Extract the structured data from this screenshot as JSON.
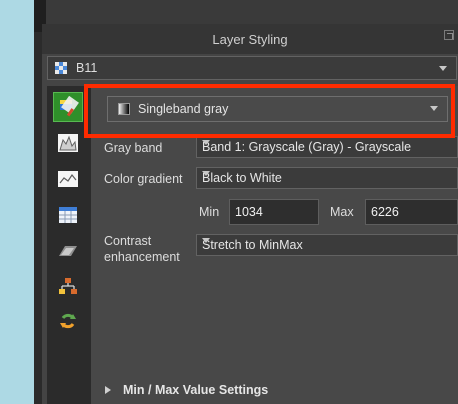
{
  "panel": {
    "title": "Layer Styling"
  },
  "layer_selector": {
    "value": "B11",
    "icon": "raster-layer-icon"
  },
  "renderer": {
    "value": "Singleband gray",
    "icon": "singleband-gray-icon"
  },
  "side_tabs": [
    {
      "name": "symbology-tab",
      "icon": "paintbrush-icon"
    },
    {
      "name": "histogram-tab",
      "icon": "histogram-icon"
    },
    {
      "name": "transparency-tab",
      "icon": "transparency-icon"
    },
    {
      "name": "information-tab",
      "icon": "table-icon"
    },
    {
      "name": "pyramids-tab",
      "icon": "pyramids-icon"
    },
    {
      "name": "style-manager-tab",
      "icon": "style-manager-icon"
    },
    {
      "name": "history-tab",
      "icon": "history-icon"
    }
  ],
  "settings": {
    "gray_band": {
      "label": "Gray band",
      "value": "Band 1: Grayscale (Gray) - Grayscale"
    },
    "color_gradient": {
      "label": "Color gradient",
      "value": "Black to White"
    },
    "min": {
      "label": "Min",
      "value": "1034"
    },
    "max": {
      "label": "Max",
      "value": "6226"
    },
    "contrast": {
      "label_line1": "Contrast",
      "label_line2": "enhancement",
      "value": "Stretch to MinMax"
    }
  },
  "min_max_section": {
    "label": "Min / Max Value Settings"
  },
  "colors": {
    "highlight": "#ff2b00",
    "active_tab": "#2f8f2a",
    "left_background": "#add9e4"
  }
}
